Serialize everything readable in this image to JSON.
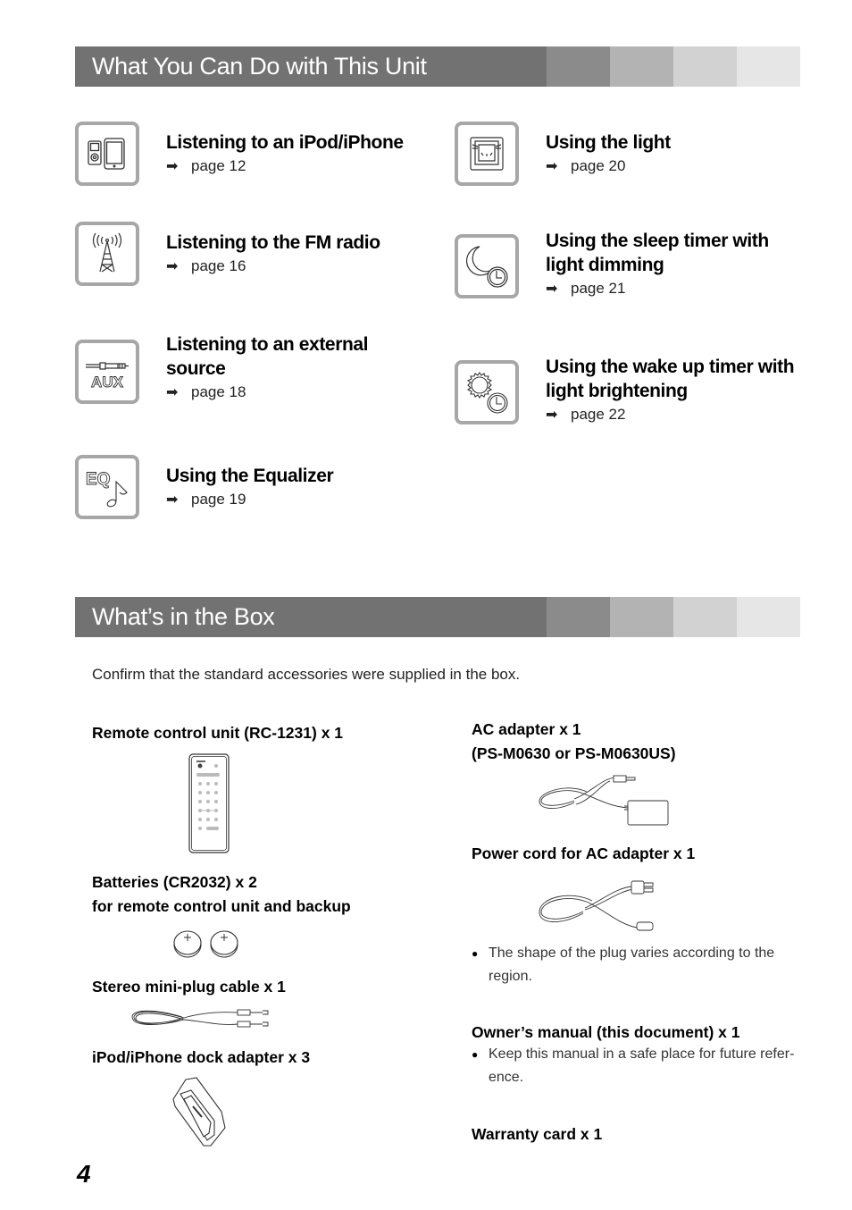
{
  "section1": {
    "title": "What You Can Do with This Unit",
    "features": [
      {
        "title": "Listening to an iPod/iPhone",
        "arrow": "➡",
        "page": "page 12",
        "icon": "ipod-iphone-icon"
      },
      {
        "title": "Listening to the FM radio",
        "arrow": "➡",
        "page": "page 16",
        "icon": "radio-tower-icon"
      },
      {
        "title": "Listening to an external source",
        "arrow": "➡",
        "page": "page 18",
        "icon": "aux-icon"
      },
      {
        "title": "Using the Equalizer",
        "arrow": "➡",
        "page": "page 19",
        "icon": "equalizer-icon"
      },
      {
        "title": "Using the light",
        "arrow": "➡",
        "page": "page 20",
        "icon": "light-icon"
      },
      {
        "title": "Using the sleep timer with light dimming",
        "arrow": "➡",
        "page": "page 21",
        "icon": "sleep-timer-icon"
      },
      {
        "title": "Using the wake up timer with light brightening",
        "arrow": "➡",
        "page": "page 22",
        "icon": "wake-timer-icon"
      }
    ]
  },
  "section2": {
    "title": "What’s in the Box",
    "intro": "Confirm that the standard accessories were supplied in the box.",
    "items": {
      "remote": "Remote control unit (RC-1231) x 1",
      "batteries_line1": "Batteries (CR2032) x 2",
      "batteries_line2": "for remote control unit and backup",
      "cable": "Stereo mini-plug cable x 1",
      "dock": "iPod/iPhone dock adapter x 3",
      "ac_line1": "AC adapter x 1",
      "ac_line2": "(PS-M0630 or PS-M0630US)",
      "power_cord": "Power cord for AC adapter x 1",
      "power_cord_note": "The shape of the plug varies according to the region.",
      "manual": "Owner’s manual (this document) x 1",
      "manual_note": "Keep this manual in a safe place for future refer-ence.",
      "warranty": "Warranty card x 1"
    }
  },
  "page_number": "4"
}
